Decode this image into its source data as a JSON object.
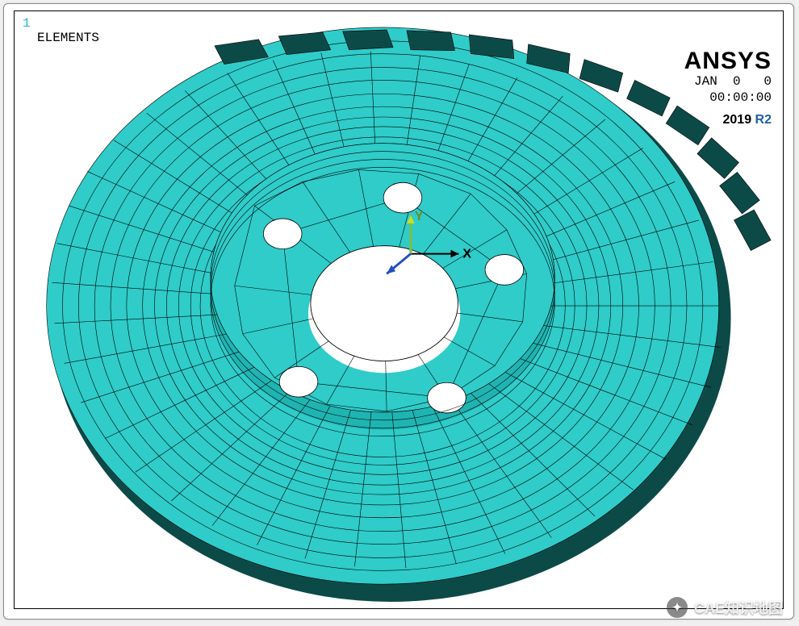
{
  "topLeft": {
    "viewNumber": "1",
    "plotLabel": "ELEMENTS"
  },
  "brand": {
    "name": "ANSYS",
    "version_prefix": "2019 ",
    "version_suffix": "R2"
  },
  "date": "JAN  0   0",
  "time": "00:00:00",
  "triad": {
    "x": "X",
    "y": "Y"
  },
  "colors": {
    "meshFill": "#2fccc9",
    "meshShade": "#0c4a48",
    "accentText": "#23b8d6"
  },
  "watermark": {
    "text": "CAE知识地图"
  }
}
